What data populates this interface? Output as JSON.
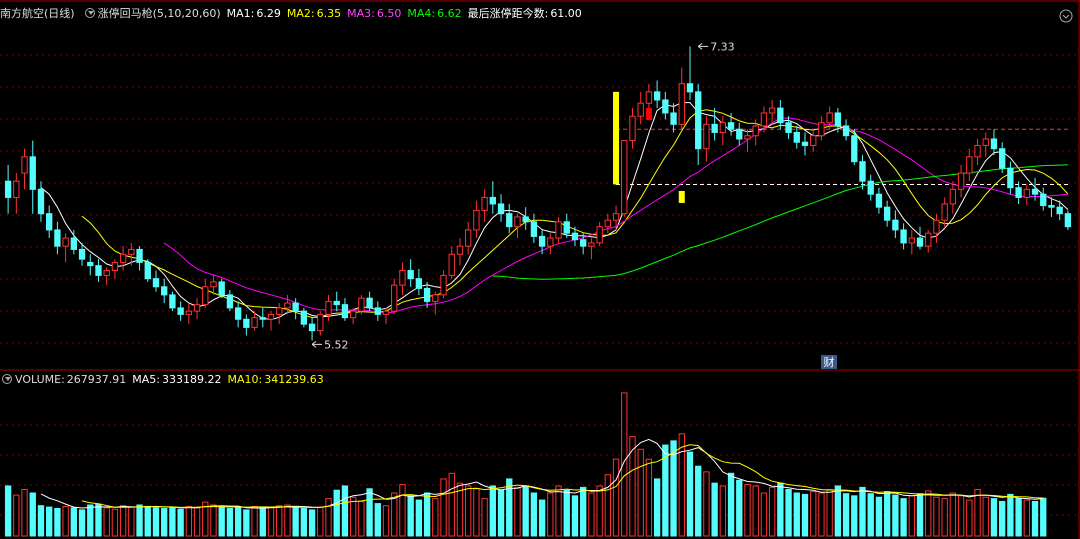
{
  "header": {
    "stock_name": "南方航空(日线)",
    "indicator_name": "涨停回马枪",
    "indicator_params": "(5,10,20,60)",
    "ma1_label": "MA1:",
    "ma1_value": "6.29",
    "ma2_label": "MA2:",
    "ma2_value": "6.35",
    "ma3_label": "MA3:",
    "ma3_value": "6.50",
    "ma4_label": "MA4:",
    "ma4_value": "6.62",
    "last_limit_label": "最后涨停距今数:",
    "last_limit_value": "61.00"
  },
  "volume_header": {
    "volume_label": "VOLUME:",
    "volume_value": "267937.91",
    "ma5_label": "MA5:",
    "ma5_value": "333189.22",
    "ma10_label": "MA10:",
    "ma10_value": "341239.63"
  },
  "annotations": {
    "high_label": "7.33",
    "low_label": "5.52",
    "fin_badge": "财"
  },
  "colors": {
    "up": "#ff3232",
    "down": "#54fcfc",
    "ma1": "#ffffff",
    "ma2": "#ffff00",
    "ma3": "#ff00ff",
    "ma4": "#00ff00",
    "grid": "#7a0000",
    "signal": "#ffff00",
    "marker_red": "#ff0000",
    "dashed": "#ffffff",
    "badge_bg": "#3a5a8c"
  },
  "chart_data": [
    {
      "type": "candlestick",
      "title": "南方航空(日线)",
      "ylim": [
        5.35,
        7.48
      ],
      "ohlc": [
        [
          6.5,
          6.6,
          6.3,
          6.4
        ],
        [
          6.4,
          6.55,
          6.3,
          6.5
        ],
        [
          6.55,
          6.7,
          6.45,
          6.65
        ],
        [
          6.65,
          6.75,
          6.3,
          6.45
        ],
        [
          6.45,
          6.5,
          6.25,
          6.3
        ],
        [
          6.3,
          6.35,
          6.15,
          6.2
        ],
        [
          6.2,
          6.25,
          6.05,
          6.1
        ],
        [
          6.1,
          6.18,
          6.0,
          6.15
        ],
        [
          6.15,
          6.2,
          6.05,
          6.08
        ],
        [
          6.08,
          6.12,
          5.98,
          6.02
        ],
        [
          6.0,
          6.05,
          5.92,
          5.98
        ],
        [
          5.98,
          6.02,
          5.88,
          5.92
        ],
        [
          5.92,
          5.97,
          5.86,
          5.95
        ],
        [
          5.95,
          6.02,
          5.9,
          6.0
        ],
        [
          6.0,
          6.1,
          5.95,
          6.05
        ],
        [
          6.05,
          6.12,
          5.98,
          6.08
        ],
        [
          6.08,
          6.1,
          5.95,
          6.0
        ],
        [
          6.0,
          6.02,
          5.88,
          5.9
        ],
        [
          5.9,
          5.95,
          5.82,
          5.85
        ],
        [
          5.85,
          5.9,
          5.75,
          5.8
        ],
        [
          5.8,
          5.82,
          5.7,
          5.72
        ],
        [
          5.72,
          5.76,
          5.64,
          5.68
        ],
        [
          5.68,
          5.75,
          5.62,
          5.7
        ],
        [
          5.7,
          5.78,
          5.65,
          5.74
        ],
        [
          5.74,
          5.9,
          5.72,
          5.85
        ],
        [
          5.85,
          5.92,
          5.8,
          5.88
        ],
        [
          5.88,
          5.9,
          5.78,
          5.8
        ],
        [
          5.8,
          5.83,
          5.7,
          5.72
        ],
        [
          5.72,
          5.76,
          5.6,
          5.65
        ],
        [
          5.65,
          5.68,
          5.55,
          5.6
        ],
        [
          5.6,
          5.7,
          5.58,
          5.66
        ],
        [
          5.66,
          5.72,
          5.6,
          5.65
        ],
        [
          5.65,
          5.7,
          5.58,
          5.68
        ],
        [
          5.68,
          5.75,
          5.62,
          5.72
        ],
        [
          5.72,
          5.8,
          5.68,
          5.75
        ],
        [
          5.75,
          5.78,
          5.65,
          5.7
        ],
        [
          5.7,
          5.72,
          5.6,
          5.62
        ],
        [
          5.62,
          5.66,
          5.52,
          5.58
        ],
        [
          5.58,
          5.7,
          5.55,
          5.68
        ],
        [
          5.68,
          5.8,
          5.64,
          5.76
        ],
        [
          5.76,
          5.82,
          5.7,
          5.74
        ],
        [
          5.74,
          5.78,
          5.64,
          5.66
        ],
        [
          5.66,
          5.72,
          5.62,
          5.7
        ],
        [
          5.7,
          5.8,
          5.68,
          5.78
        ],
        [
          5.78,
          5.82,
          5.7,
          5.72
        ],
        [
          5.72,
          5.76,
          5.64,
          5.68
        ],
        [
          5.68,
          5.72,
          5.62,
          5.7
        ],
        [
          5.7,
          5.9,
          5.68,
          5.86
        ],
        [
          5.86,
          6.0,
          5.8,
          5.95
        ],
        [
          5.95,
          6.02,
          5.85,
          5.9
        ],
        [
          5.9,
          5.96,
          5.8,
          5.84
        ],
        [
          5.84,
          5.88,
          5.72,
          5.76
        ],
        [
          5.76,
          5.82,
          5.68,
          5.8
        ],
        [
          5.8,
          5.95,
          5.78,
          5.92
        ],
        [
          5.92,
          6.1,
          5.9,
          6.05
        ],
        [
          6.05,
          6.15,
          5.98,
          6.1
        ],
        [
          6.1,
          6.25,
          6.05,
          6.2
        ],
        [
          6.2,
          6.38,
          6.15,
          6.32
        ],
        [
          6.32,
          6.45,
          6.25,
          6.4
        ],
        [
          6.4,
          6.5,
          6.3,
          6.36
        ],
        [
          6.36,
          6.42,
          6.25,
          6.3
        ],
        [
          6.3,
          6.36,
          6.18,
          6.22
        ],
        [
          6.22,
          6.3,
          6.15,
          6.28
        ],
        [
          6.28,
          6.34,
          6.2,
          6.25
        ],
        [
          6.25,
          6.3,
          6.12,
          6.16
        ],
        [
          6.16,
          6.2,
          6.05,
          6.1
        ],
        [
          6.1,
          6.18,
          6.05,
          6.15
        ],
        [
          6.15,
          6.28,
          6.12,
          6.25
        ],
        [
          6.25,
          6.3,
          6.15,
          6.18
        ],
        [
          6.18,
          6.22,
          6.1,
          6.14
        ],
        [
          6.14,
          6.18,
          6.05,
          6.1
        ],
        [
          6.1,
          6.15,
          6.02,
          6.12
        ],
        [
          6.12,
          6.25,
          6.1,
          6.22
        ],
        [
          6.22,
          6.3,
          6.18,
          6.26
        ],
        [
          6.26,
          6.35,
          6.2,
          6.3
        ],
        [
          6.3,
          6.75,
          6.28,
          6.75
        ],
        [
          6.75,
          6.95,
          6.7,
          6.9
        ],
        [
          6.9,
          7.05,
          6.85,
          6.98
        ],
        [
          6.98,
          7.1,
          6.9,
          7.05
        ],
        [
          7.05,
          7.12,
          6.95,
          7.0
        ],
        [
          7.0,
          7.05,
          6.88,
          6.92
        ],
        [
          6.92,
          6.98,
          6.8,
          6.85
        ],
        [
          6.85,
          7.2,
          6.82,
          7.1
        ],
        [
          7.1,
          7.33,
          7.0,
          7.05
        ],
        [
          7.05,
          7.1,
          6.6,
          6.7
        ],
        [
          6.7,
          6.9,
          6.62,
          6.85
        ],
        [
          6.85,
          6.95,
          6.75,
          6.8
        ],
        [
          6.8,
          6.9,
          6.72,
          6.86
        ],
        [
          6.86,
          6.92,
          6.78,
          6.82
        ],
        [
          6.82,
          6.86,
          6.72,
          6.76
        ],
        [
          6.76,
          6.82,
          6.68,
          6.78
        ],
        [
          6.78,
          6.88,
          6.72,
          6.84
        ],
        [
          6.84,
          6.96,
          6.8,
          6.92
        ],
        [
          6.92,
          7.0,
          6.85,
          6.95
        ],
        [
          6.95,
          7.0,
          6.82,
          6.86
        ],
        [
          6.86,
          6.9,
          6.76,
          6.8
        ],
        [
          6.8,
          6.84,
          6.7,
          6.74
        ],
        [
          6.74,
          6.8,
          6.66,
          6.72
        ],
        [
          6.72,
          6.82,
          6.68,
          6.78
        ],
        [
          6.78,
          6.9,
          6.75,
          6.86
        ],
        [
          6.86,
          6.96,
          6.82,
          6.92
        ],
        [
          6.92,
          6.95,
          6.8,
          6.84
        ],
        [
          6.84,
          6.88,
          6.75,
          6.78
        ],
        [
          6.78,
          6.82,
          6.6,
          6.62
        ],
        [
          6.62,
          6.66,
          6.45,
          6.5
        ],
        [
          6.5,
          6.54,
          6.38,
          6.42
        ],
        [
          6.42,
          6.46,
          6.3,
          6.34
        ],
        [
          6.34,
          6.38,
          6.22,
          6.26
        ],
        [
          6.26,
          6.32,
          6.15,
          6.2
        ],
        [
          6.2,
          6.24,
          6.08,
          6.12
        ],
        [
          6.12,
          6.2,
          6.05,
          6.15
        ],
        [
          6.15,
          6.22,
          6.08,
          6.1
        ],
        [
          6.1,
          6.2,
          6.06,
          6.18
        ],
        [
          6.18,
          6.3,
          6.12,
          6.26
        ],
        [
          6.26,
          6.4,
          6.22,
          6.36
        ],
        [
          6.36,
          6.5,
          6.3,
          6.45
        ],
        [
          6.45,
          6.6,
          6.4,
          6.55
        ],
        [
          6.55,
          6.7,
          6.5,
          6.65
        ],
        [
          6.65,
          6.76,
          6.6,
          6.72
        ],
        [
          6.72,
          6.8,
          6.65,
          6.76
        ],
        [
          6.76,
          6.82,
          6.66,
          6.7
        ],
        [
          6.7,
          6.74,
          6.55,
          6.58
        ],
        [
          6.58,
          6.62,
          6.42,
          6.46
        ],
        [
          6.46,
          6.5,
          6.36,
          6.4
        ],
        [
          6.4,
          6.48,
          6.35,
          6.45
        ],
        [
          6.45,
          6.52,
          6.38,
          6.42
        ],
        [
          6.42,
          6.46,
          6.32,
          6.35
        ],
        [
          6.35,
          6.4,
          6.28,
          6.34
        ],
        [
          6.34,
          6.38,
          6.26,
          6.3
        ],
        [
          6.3,
          6.32,
          6.2,
          6.22
        ]
      ],
      "volume": [
        355000,
        290000,
        330000,
        305000,
        215000,
        205000,
        195000,
        210000,
        200000,
        185000,
        220000,
        225000,
        200000,
        190000,
        215000,
        205000,
        220000,
        210000,
        200000,
        195000,
        205000,
        190000,
        210000,
        200000,
        240000,
        220000,
        205000,
        195000,
        200000,
        185000,
        210000,
        200000,
        205000,
        215000,
        220000,
        210000,
        195000,
        185000,
        205000,
        265000,
        325000,
        355000,
        275000,
        245000,
        335000,
        230000,
        215000,
        305000,
        365000,
        285000,
        255000,
        305000,
        265000,
        405000,
        445000,
        375000,
        355000,
        335000,
        265000,
        355000,
        325000,
        405000,
        345000,
        355000,
        305000,
        255000,
        305000,
        355000,
        325000,
        285000,
        345000,
        305000,
        355000,
        435000,
        545000,
        1015000,
        705000,
        615000,
        545000,
        405000,
        645000,
        675000,
        725000,
        595000,
        495000,
        455000,
        375000,
        355000,
        445000,
        395000,
        365000,
        355000,
        305000,
        345000,
        375000,
        330000,
        305000,
        295000,
        315000,
        305000,
        330000,
        355000,
        300000,
        285000,
        345000,
        300000,
        275000,
        315000,
        290000,
        265000,
        285000,
        300000,
        320000,
        275000,
        265000,
        305000,
        285000,
        255000,
        330000,
        275000,
        265000,
        245000,
        295000,
        265000,
        255000,
        245000,
        268000
      ],
      "vol_ylim": [
        0,
        1050000
      ],
      "series": [
        {
          "name": "MA1",
          "source": "close",
          "period": 5
        },
        {
          "name": "MA2",
          "source": "close",
          "period": 10
        },
        {
          "name": "MA3",
          "source": "close",
          "period": 20
        },
        {
          "name": "MA4",
          "source": "close",
          "period": 60
        }
      ],
      "volume_series": [
        {
          "name": "MA5",
          "period": 5
        },
        {
          "name": "MA10",
          "period": 10
        }
      ],
      "hlines": [
        6.82,
        6.48
      ],
      "annotations": [
        {
          "label": "7.33",
          "index": 84,
          "value": 7.33
        },
        {
          "label": "5.52",
          "index": 37,
          "value": 5.52
        }
      ]
    }
  ]
}
